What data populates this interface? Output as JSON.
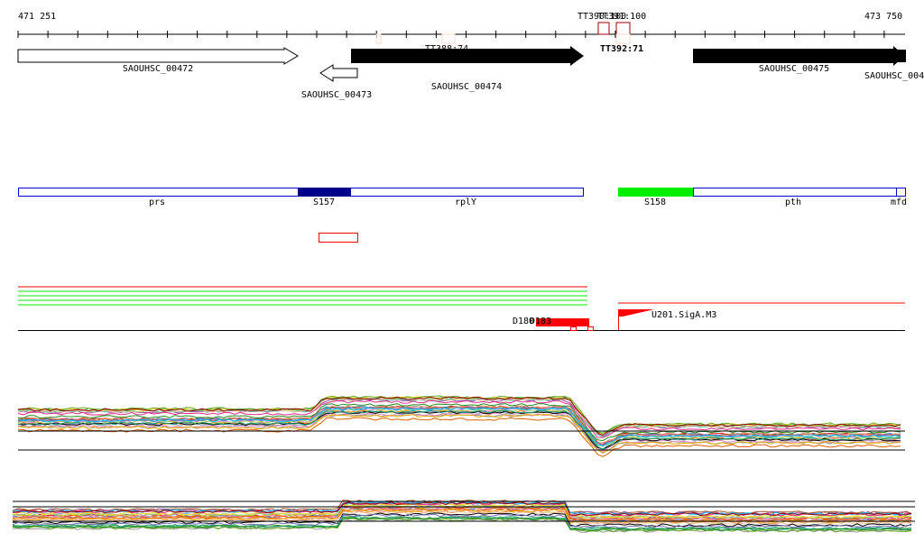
{
  "ruler": {
    "start": "471 251",
    "end": "473 750"
  },
  "terminators": [
    {
      "label": "TT388:74",
      "color": "#f5d8c8"
    },
    {
      "label": "TT390:100",
      "color": "#a00000"
    },
    {
      "label": "TT391:100",
      "color": "#a00000"
    },
    {
      "label": "TT392:71",
      "color": "#f5d8c8"
    }
  ],
  "genes": [
    {
      "label": "SAOUHSC_00472",
      "strand": "+",
      "filled": false
    },
    {
      "label": "SAOUHSC_00473",
      "strand": "-",
      "filled": false
    },
    {
      "label": "SAOUHSC_00474",
      "strand": "+",
      "filled": true
    },
    {
      "label": "SAOUHSC_00475",
      "strand": "+",
      "filled": true
    },
    {
      "label": "SAOUHSC_004",
      "strand": "+",
      "filled": true
    }
  ],
  "operons": [
    {
      "label": "prs",
      "color": "#ffffff"
    },
    {
      "label": "S157",
      "color": "#00008b"
    },
    {
      "label": "rplY",
      "color": "#ffffff"
    },
    {
      "label": "S158",
      "color": "#00ee00"
    },
    {
      "label": "pth",
      "color": "#ffffff"
    },
    {
      "label": "mfd",
      "color": "#ffffff"
    }
  ],
  "features": {
    "d1": "D180",
    "d2": "D183",
    "promoter": "U201.SigA.M3"
  },
  "colors": {
    "red": "#ff0000",
    "green": "#00ee00",
    "blue": "#0000cc"
  },
  "wiggle_colors": [
    "#e41a1c",
    "#377eb8",
    "#4daf4a",
    "#984ea3",
    "#ff7f00",
    "#a65628",
    "#f781bf",
    "#999999",
    "#66c2a5",
    "#fc8d62",
    "#8da0cb",
    "#e78ac3",
    "#a6d854",
    "#ffd92f",
    "#e5c494",
    "#000000",
    "#1b9e77",
    "#d95f02",
    "#7570b3",
    "#e7298a",
    "#66a61e",
    "#e6ab02",
    "#00bfff",
    "#8b0000",
    "#228b22"
  ]
}
